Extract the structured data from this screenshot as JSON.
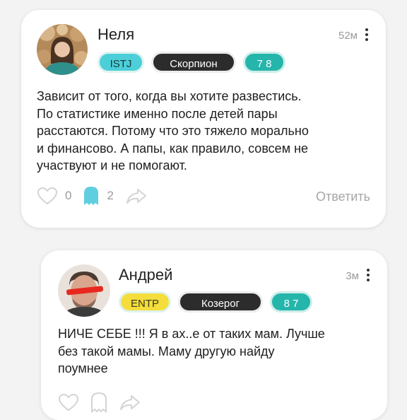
{
  "comments": [
    {
      "author": "Неля",
      "time": "52м",
      "badges": {
        "type": "ISTJ",
        "zodiac": "Скорпион",
        "numbers": "7 8"
      },
      "colors": {
        "type_bg": "#4ccfd9",
        "type_text": "#1a3b3d"
      },
      "text": "Зависит от того, когда вы хотите развестись.\nПо статистике именно после детей пары\nрасстаются. Потому что это тяжело морально\nи финансово. А папы, как правило, совсем не\nучаствуют и не помогают.",
      "likes": "0",
      "reactions": "2",
      "reply_label": "Ответить"
    },
    {
      "author": "Андрей",
      "time": "3м",
      "badges": {
        "type": "ENTP",
        "zodiac": "Козерог",
        "numbers": "8 7"
      },
      "colors": {
        "type_bg": "#f4dd3c",
        "type_text": "#3a3a1a"
      },
      "text": "НИЧЕ СЕБЕ !!! Я в ах..е от таких мам. Лучше\nбез такой мамы. Маму другую найду\nпоумнее"
    }
  ],
  "icons": {
    "menu": "more-vertical-icon",
    "like": "heart-icon",
    "reaction": "ghost-icon",
    "share": "share-arrow-icon",
    "numbers_separator": "leaf-icon"
  },
  "accent": "#25b5ab"
}
